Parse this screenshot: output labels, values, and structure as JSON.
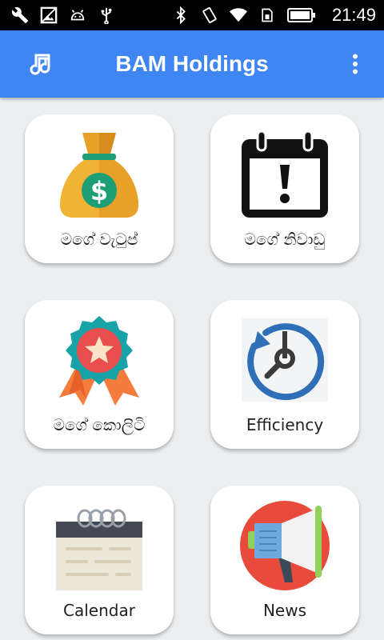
{
  "status_bar": {
    "time": "21:49",
    "left_icons": [
      "wrench-icon",
      "image-icon",
      "android-icon",
      "usb-icon"
    ],
    "right_icons": [
      "bluetooth-icon",
      "vibrate-icon",
      "wifi-icon",
      "sim-icon",
      "battery-icon"
    ]
  },
  "app_bar": {
    "title": "BAM Holdings",
    "left_icon": "music-note-icon",
    "right_icon": "more-vert-icon",
    "color": "#3f86f4"
  },
  "menu": {
    "items": [
      {
        "label": "මගේ වැටුප්",
        "icon": "money-bag-icon"
      },
      {
        "label": "මගේ නිවාඩු",
        "icon": "calendar-alert-icon"
      },
      {
        "label": "මගේ කොලිටි",
        "icon": "award-badge-icon"
      },
      {
        "label": "Efficiency",
        "icon": "stopwatch-icon"
      },
      {
        "label": "Calendar",
        "icon": "notepad-calendar-icon"
      },
      {
        "label": "News",
        "icon": "megaphone-icon"
      }
    ]
  }
}
